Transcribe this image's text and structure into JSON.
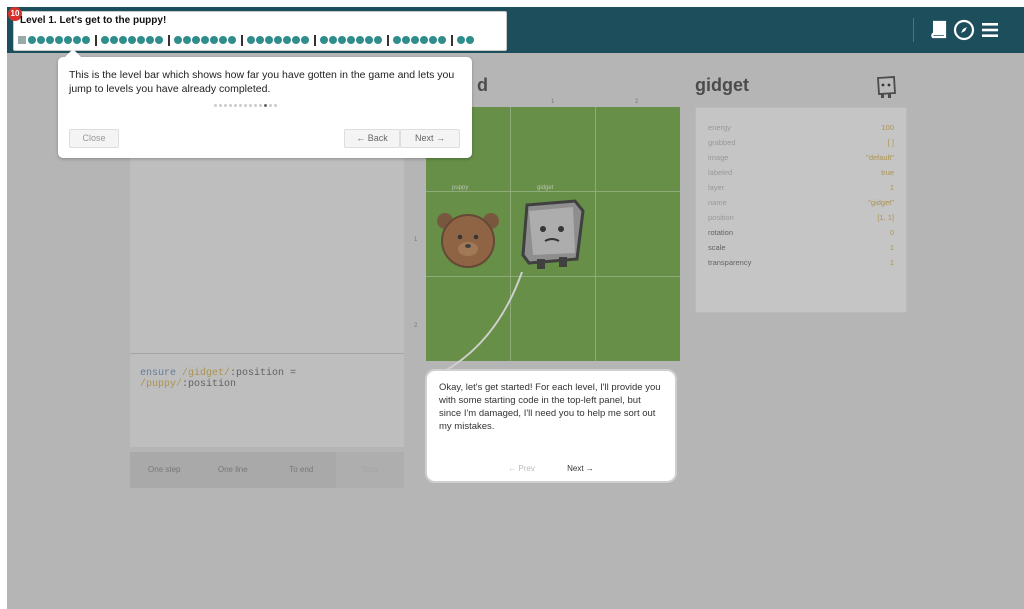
{
  "level_bar": {
    "badge": "10",
    "title": "Level 1. Let's get to the puppy!",
    "groups": [
      7,
      7,
      7,
      7,
      7,
      6,
      2
    ]
  },
  "tooltip": {
    "text": "This is the level bar which shows how far you have gotten in the game and lets you jump to levels you have already completed.",
    "step_total": 13,
    "step_active": 11,
    "close_label": "Close",
    "back_label": "← Back",
    "next_label": "Next →"
  },
  "world": {
    "title_visible": "d",
    "col_numbers": [
      "1",
      "2"
    ],
    "row_numbers": [
      "1",
      "2"
    ],
    "cell_labels": [
      "puppy",
      "gidget"
    ]
  },
  "test_panel": {
    "keyword": "ensure",
    "ref1": "/gidget/",
    "prop1": ":position = ",
    "ref2": "/puppy/",
    "prop2": ":position"
  },
  "controls": [
    "One step",
    "One line",
    "To end",
    "Stop"
  ],
  "speech": {
    "text": "Okay, let's get started! For each level, I'll provide you with some starting code in the top-left panel, but since I'm damaged, I'll need you to help me sort out my mistakes.",
    "prev_label": "← Prev",
    "next_label": "Next →"
  },
  "gidget_panel": {
    "title": "gidget",
    "properties": [
      {
        "name": "energy",
        "value": "100"
      },
      {
        "name": "grabbed",
        "value": "[ ]"
      },
      {
        "name": "image",
        "value": "\"default\""
      },
      {
        "name": "labeled",
        "value": "true"
      },
      {
        "name": "layer",
        "value": "1"
      },
      {
        "name": "name",
        "value": "\"gidget\""
      },
      {
        "name": "position",
        "value": "[1, 1]"
      },
      {
        "name": "rotation",
        "value": "0"
      },
      {
        "name": "scale",
        "value": "1"
      },
      {
        "name": "transparency",
        "value": "1"
      }
    ]
  },
  "colors": {
    "topbar": "#1d4e5c",
    "level_dot": "#2f8d8c",
    "badge": "#d7312b",
    "grass": "#5f9b2e",
    "string_value": "#c7a23a"
  },
  "icons": [
    "book-icon",
    "compass-icon",
    "menu-icon"
  ]
}
